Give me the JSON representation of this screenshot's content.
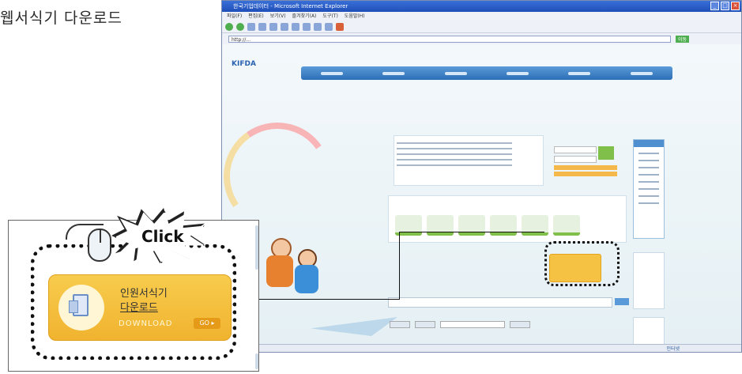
{
  "caption": "웹서식기 다운로드",
  "browser": {
    "title": "한국기업데이터 - Microsoft Internet Explorer",
    "menu": [
      "파일(F)",
      "편집(E)",
      "보기(V)",
      "즐겨찾기(A)",
      "도구(T)",
      "도움말(H)"
    ],
    "address": "http://...",
    "go_label": "이동"
  },
  "zoom_callout": {
    "click_label": "Click",
    "title_line1": "인원서식기",
    "title_line2": "다운로드",
    "download_en": "DOWNLOAD",
    "go_label": "GO ▸"
  },
  "statusbar": {
    "zone": "인터넷"
  }
}
